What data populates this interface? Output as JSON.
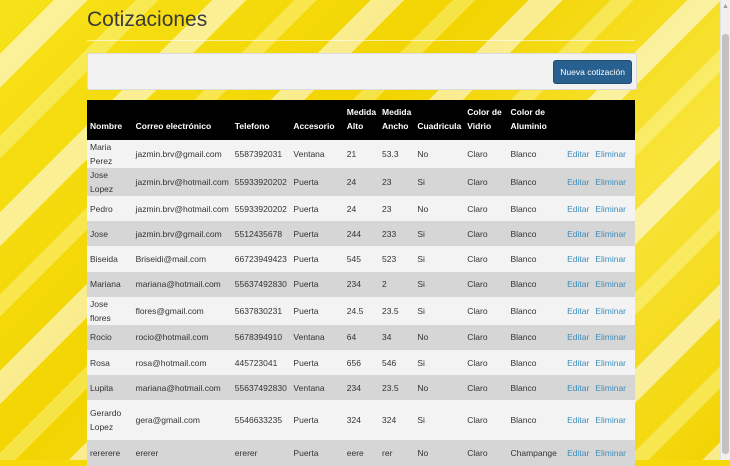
{
  "page": {
    "title": "Cotizaciones"
  },
  "toolbar": {
    "new_label": "Nueva cotización"
  },
  "table": {
    "headers": [
      "Nombre",
      "Correo electrónico",
      "Telefono",
      "Accesorio",
      "Medida Alto",
      "Medida Ancho",
      "Cuadricula",
      "Color de Vidrio",
      "Color de Aluminio"
    ],
    "edit_label": "Editar",
    "delete_label": "Eliminar",
    "rows": [
      [
        "Maria Perez",
        "jazmin.brv@gmail.com",
        "5587392031",
        "Ventana",
        "21",
        "53.3",
        "No",
        "Claro",
        "Blanco"
      ],
      [
        "Jose Lopez",
        "jazmin.brv@hotmail.com",
        "55933920202",
        "Puerta",
        "24",
        "23",
        "Si",
        "Claro",
        "Blanco"
      ],
      [
        "Pedro",
        "jazmin.brv@hotmail.com",
        "55933920202",
        "Puerta",
        "24",
        "23",
        "No",
        "Claro",
        "Blanco"
      ],
      [
        "Jose",
        "jazmin.brv@gmail.com",
        "5512435678",
        "Puerta",
        "244",
        "233",
        "Si",
        "Claro",
        "Blanco"
      ],
      [
        "Biseida",
        "Briseidi@mail.com",
        "66723949423",
        "Puerta",
        "545",
        "523",
        "Si",
        "Claro",
        "Blanco"
      ],
      [
        "Mariana",
        "mariana@hotmail.com",
        "55637492830",
        "Puerta",
        "234",
        "2",
        "Si",
        "Claro",
        "Blanco"
      ],
      [
        "Jose flores",
        "flores@gmail.com",
        "5637830231",
        "Puerta",
        "24.5",
        "23.5",
        "Si",
        "Claro",
        "Blanco"
      ],
      [
        "Rocio",
        "rocio@hotmail.com",
        "5678394910",
        "Ventana",
        "64",
        "34",
        "No",
        "Claro",
        "Blanco"
      ],
      [
        "Rosa",
        "rosa@hotmail.com",
        "445723041",
        "Puerta",
        "656",
        "546",
        "Si",
        "Claro",
        "Blanco"
      ],
      [
        "Lupita",
        "mariana@hotmail.com",
        "55637492830",
        "Ventana",
        "234",
        "23.5",
        "No",
        "Claro",
        "Blanco"
      ],
      [
        "Gerardo Lopez",
        "gera@gmail.com",
        "5546633235",
        "Puerta",
        "324",
        "324",
        "Si",
        "Claro",
        "Blanco"
      ],
      [
        "rererere",
        "ererer",
        "ererer",
        "Puerta",
        "eere",
        "rer",
        "No",
        "Claro",
        "Champange"
      ]
    ]
  },
  "colors": {
    "header_bg": "#000000",
    "link": "#3c8dbc",
    "button": "#286090",
    "background": "#f5d90a"
  }
}
